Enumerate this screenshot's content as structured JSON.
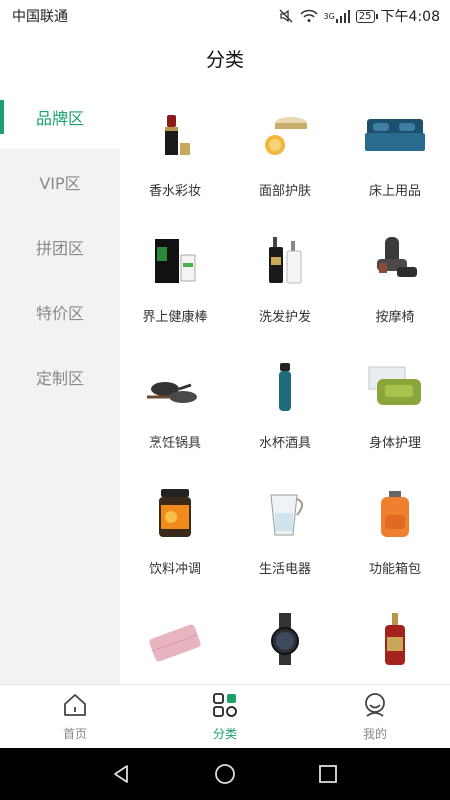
{
  "status_bar": {
    "carrier": "中国联通",
    "network": "3G",
    "battery": "25",
    "time": "下午4:08"
  },
  "header": {
    "title": "分类"
  },
  "sidebar": {
    "items": [
      {
        "label": "品牌区",
        "active": true
      },
      {
        "label": "VIP区",
        "active": false
      },
      {
        "label": "拼团区",
        "active": false
      },
      {
        "label": "特价区",
        "active": false
      },
      {
        "label": "定制区",
        "active": false
      }
    ]
  },
  "categories": [
    {
      "label": "香水彩妆",
      "icon": "lipstick-icon"
    },
    {
      "label": "面部护肤",
      "icon": "face-cream-icon"
    },
    {
      "label": "床上用品",
      "icon": "bedding-icon"
    },
    {
      "label": "界上健康棒",
      "icon": "health-stick-box-icon"
    },
    {
      "label": "洗发护发",
      "icon": "shampoo-bottles-icon"
    },
    {
      "label": "按摩椅",
      "icon": "massage-chair-icon"
    },
    {
      "label": "烹饪锅具",
      "icon": "cookware-pans-icon"
    },
    {
      "label": "水杯酒具",
      "icon": "water-bottle-icon"
    },
    {
      "label": "身体护理",
      "icon": "soap-bar-icon"
    },
    {
      "label": "饮料冲调",
      "icon": "honey-jar-icon"
    },
    {
      "label": "生活电器",
      "icon": "water-filter-pitcher-icon"
    },
    {
      "label": "功能箱包",
      "icon": "backpack-icon"
    },
    {
      "label": "",
      "icon": "wallet-icon"
    },
    {
      "label": "",
      "icon": "wristwatch-icon"
    },
    {
      "label": "",
      "icon": "serum-bottle-icon"
    }
  ],
  "tabbar": {
    "items": [
      {
        "label": "首页",
        "icon": "home-icon",
        "active": false
      },
      {
        "label": "分类",
        "icon": "grid-category-icon",
        "active": true
      },
      {
        "label": "我的",
        "icon": "profile-icon",
        "active": false
      }
    ]
  },
  "colors": {
    "accent": "#19a26b",
    "sidebar_bg": "#f2f2f2",
    "inactive_text": "#8a8a8a"
  }
}
